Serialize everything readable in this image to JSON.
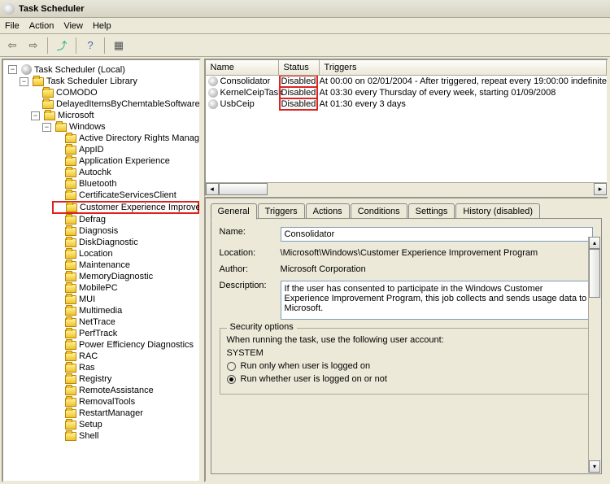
{
  "window": {
    "title": "Task Scheduler"
  },
  "menu": {
    "file": "File",
    "action": "Action",
    "view": "View",
    "help": "Help"
  },
  "tree": {
    "root": "Task Scheduler (Local)",
    "library": "Task Scheduler Library",
    "items": {
      "comodo": "COMODO",
      "delayed": "DelayedItemsByChemtableSoftware",
      "microsoft": "Microsoft",
      "windows": "Windows"
    },
    "win_children": [
      "Active Directory Rights Manag",
      "AppID",
      "Application Experience",
      "Autochk",
      "Bluetooth",
      "CertificateServicesClient",
      "Customer Experience Improve",
      "Defrag",
      "Diagnosis",
      "DiskDiagnostic",
      "Location",
      "Maintenance",
      "MemoryDiagnostic",
      "MobilePC",
      "MUI",
      "Multimedia",
      "NetTrace",
      "PerfTrack",
      "Power Efficiency Diagnostics",
      "RAC",
      "Ras",
      "Registry",
      "RemoteAssistance",
      "RemovalTools",
      "RestartManager",
      "Setup",
      "Shell"
    ],
    "selected_index": 6
  },
  "list": {
    "headers": {
      "name": "Name",
      "status": "Status",
      "triggers": "Triggers"
    },
    "rows": [
      {
        "name": "Consolidator",
        "status": "Disabled",
        "triggers": "At 00:00 on 02/01/2004 - After triggered, repeat every 19:00:00 indefinite"
      },
      {
        "name": "KernelCeipTask",
        "status": "Disabled",
        "triggers": "At 03:30 every Thursday of every week, starting 01/09/2008"
      },
      {
        "name": "UsbCeip",
        "status": "Disabled",
        "triggers": "At 01:30 every 3 days"
      }
    ]
  },
  "tabs": {
    "general": "General",
    "triggers": "Triggers",
    "actions": "Actions",
    "conditions": "Conditions",
    "settings": "Settings",
    "history": "History (disabled)"
  },
  "general_panel": {
    "name_label": "Name:",
    "name_value": "Consolidator",
    "location_label": "Location:",
    "location_value": "\\Microsoft\\Windows\\Customer Experience Improvement Program",
    "author_label": "Author:",
    "author_value": "Microsoft Corporation",
    "description_label": "Description:",
    "description_value": "If the user has consented to participate in the Windows Customer Experience Improvement Program, this job collects and sends usage data to Microsoft.",
    "security_legend": "Security options",
    "security_prompt": "When running the task, use the following user account:",
    "security_account": "SYSTEM",
    "run_logged_on": "Run only when user is logged on",
    "run_whether": "Run whether user is logged on or not"
  }
}
